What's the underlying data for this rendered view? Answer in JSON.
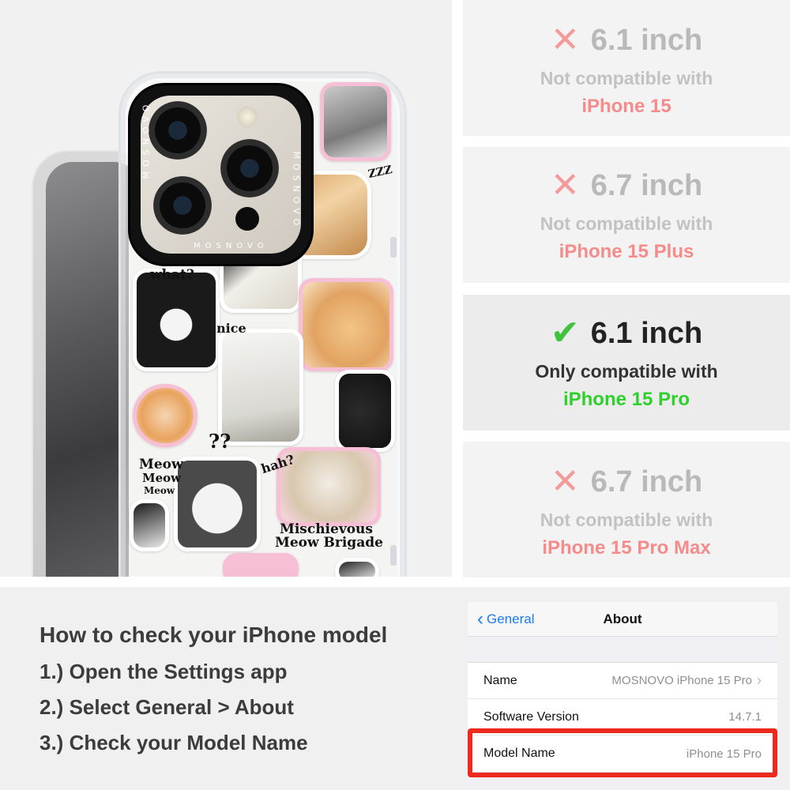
{
  "product": {
    "brand": "MOSNOVO",
    "labels": {
      "what": "what?",
      "nice": "nice",
      "meow1": "Meow",
      "meow2": "Meow",
      "meow3": "Meow",
      "hah": "hah?",
      "qq": "??",
      "ex": "!!!",
      "z": "ZZZ",
      "brigade1": "Mischievous",
      "brigade2": "Meow Brigade"
    }
  },
  "compat": [
    {
      "size": "6.1 inch",
      "status": "Not compatible with",
      "model": "iPhone 15",
      "ok": false
    },
    {
      "size": "6.7 inch",
      "status": "Not compatible with",
      "model": "iPhone 15 Plus",
      "ok": false
    },
    {
      "size": "6.1 inch",
      "status": "Only compatible with",
      "model": "iPhone 15 Pro",
      "ok": true
    },
    {
      "size": "6.7 inch",
      "status": "Not compatible with",
      "model": "iPhone 15 Pro Max",
      "ok": false
    }
  ],
  "instructions": {
    "title": "How to check your iPhone model",
    "steps": [
      "1.) Open the Settings app",
      "2.) Select General > About",
      "3.) Check your Model Name"
    ]
  },
  "ios": {
    "back": "General",
    "title": "About",
    "rows": [
      {
        "label": "Name",
        "value": "MOSNOVO iPhone 15 Pro"
      },
      {
        "label": "Software Version",
        "value": "14.7.1"
      },
      {
        "label": "Model Name",
        "value": "iPhone 15 Pro"
      }
    ]
  },
  "colors": {
    "cross": "#f39a9a",
    "check": "#3fc23c",
    "highlight": "#ee2a1f",
    "ios_link": "#1a7cf4"
  }
}
